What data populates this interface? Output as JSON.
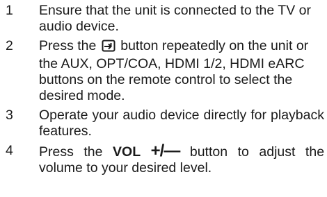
{
  "steps": [
    {
      "number": "1",
      "text": "Ensure that the unit is connected to the TV or audio device."
    },
    {
      "number": "2",
      "text_before_icon": "Press the",
      "icon": "input-source-icon",
      "text_after_icon": "button repeatedly on the unit or the AUX, OPT/COA, HDMI 1/2, HDMI eARC buttons on the remote control to select the desired mode."
    },
    {
      "number": "3",
      "text": "Operate your audio device directly for playback features."
    },
    {
      "number": "4",
      "text_before": "Press the",
      "button_label": "VOL",
      "button_symbol": "+/—",
      "text_after": "button to adjust the volume to your desired level."
    }
  ]
}
